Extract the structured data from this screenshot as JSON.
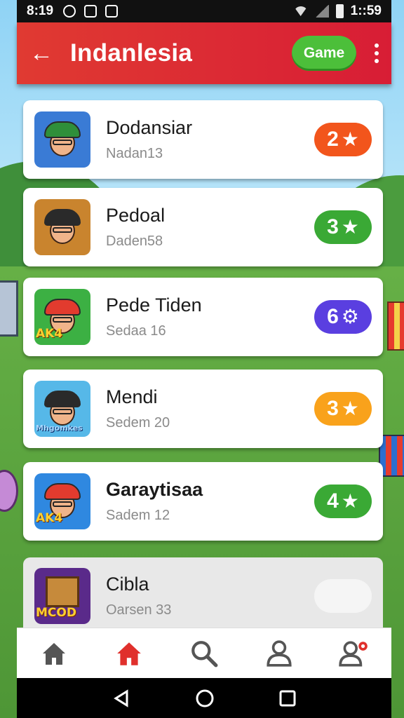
{
  "status_bar": {
    "time": "8:19",
    "clock_right": "1::59"
  },
  "app_bar": {
    "title": "Indanlesia",
    "game_button": "Game"
  },
  "list": [
    {
      "title": "Dodansiar",
      "subtitle": "Nadan13",
      "badge_value": "2",
      "badge_icon": "star-icon",
      "badge_color": "#f2551c",
      "icon_bg": "#3a7bd5",
      "title_bold": false
    },
    {
      "title": "Pedoal",
      "subtitle": "Daden58",
      "badge_value": "3",
      "badge_icon": "star-icon",
      "badge_color": "#3aa935",
      "icon_bg": "#c9842e",
      "title_bold": false
    },
    {
      "title": "Pede Tiden",
      "subtitle": "Sedaa 16",
      "badge_value": "6",
      "badge_icon": "gear-icon",
      "badge_color": "#5a3fe0",
      "icon_bg": "#3cb043",
      "title_bold": false,
      "icon_label": "AK4"
    },
    {
      "title": "Mendi",
      "subtitle": "Sedem 20",
      "badge_value": "3",
      "badge_icon": "star-icon",
      "badge_color": "#f9a21b",
      "icon_bg": "#56b8e8",
      "title_bold": false,
      "icon_label": "Mhgomkes"
    },
    {
      "title": "Garaytisaa",
      "subtitle": "Sadem 12",
      "badge_value": "4",
      "badge_icon": "star-icon",
      "badge_color": "#3aa935",
      "icon_bg": "#2f88e0",
      "title_bold": true,
      "icon_label": "AK4"
    },
    {
      "title": "Cibla",
      "subtitle": "Oarsen 33",
      "badge_value": "",
      "badge_icon": "",
      "badge_color": "#f5f5f5",
      "icon_bg": "#5a2a8a",
      "title_bold": false,
      "icon_label": "MCOD"
    }
  ],
  "bottom_nav": [
    {
      "name": "home-icon",
      "color": "#555555"
    },
    {
      "name": "home-active-icon",
      "color": "#e0302c"
    },
    {
      "name": "search-icon",
      "color": "#555555"
    },
    {
      "name": "profile-icon",
      "color": "#555555"
    },
    {
      "name": "profile-settings-icon",
      "color": "#555555"
    }
  ],
  "colors": {
    "app_bar": "#d81d35",
    "accent": "#4cbf3a"
  }
}
